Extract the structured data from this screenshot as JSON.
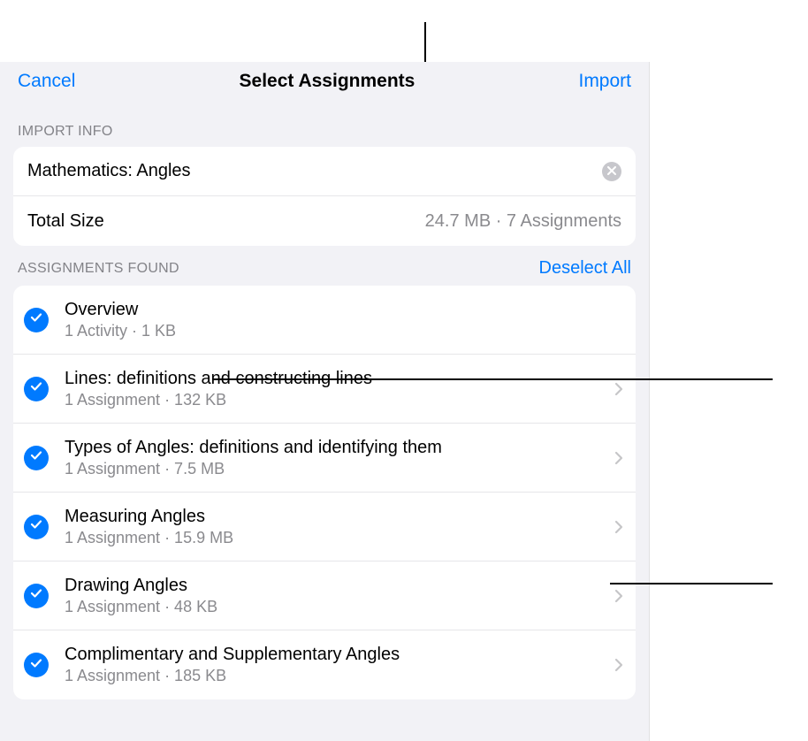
{
  "header": {
    "cancel_label": "Cancel",
    "title": "Select Assignments",
    "import_label": "Import"
  },
  "import_info": {
    "section_label": "IMPORT INFO",
    "name_value": "Mathematics: Angles",
    "total_size_label": "Total Size",
    "total_size_value": "24.7 MB · 7 Assignments"
  },
  "assignments": {
    "section_label": "ASSIGNMENTS FOUND",
    "deselect_label": "Deselect All",
    "items": [
      {
        "title": "Overview",
        "sub": "1 Activity · 1 KB",
        "has_chevron": false
      },
      {
        "title": "Lines: definitions and constructing lines",
        "sub": "1 Assignment · 132 KB",
        "has_chevron": true
      },
      {
        "title": "Types of Angles: definitions and identifying them",
        "sub": "1 Assignment · 7.5 MB",
        "has_chevron": true
      },
      {
        "title": "Measuring Angles",
        "sub": "1 Assignment · 15.9 MB",
        "has_chevron": true
      },
      {
        "title": "Drawing Angles",
        "sub": "1 Assignment · 48 KB",
        "has_chevron": true
      },
      {
        "title": "Complimentary and Supplementary Angles",
        "sub": "1 Assignment · 185 KB",
        "has_chevron": true
      }
    ]
  }
}
